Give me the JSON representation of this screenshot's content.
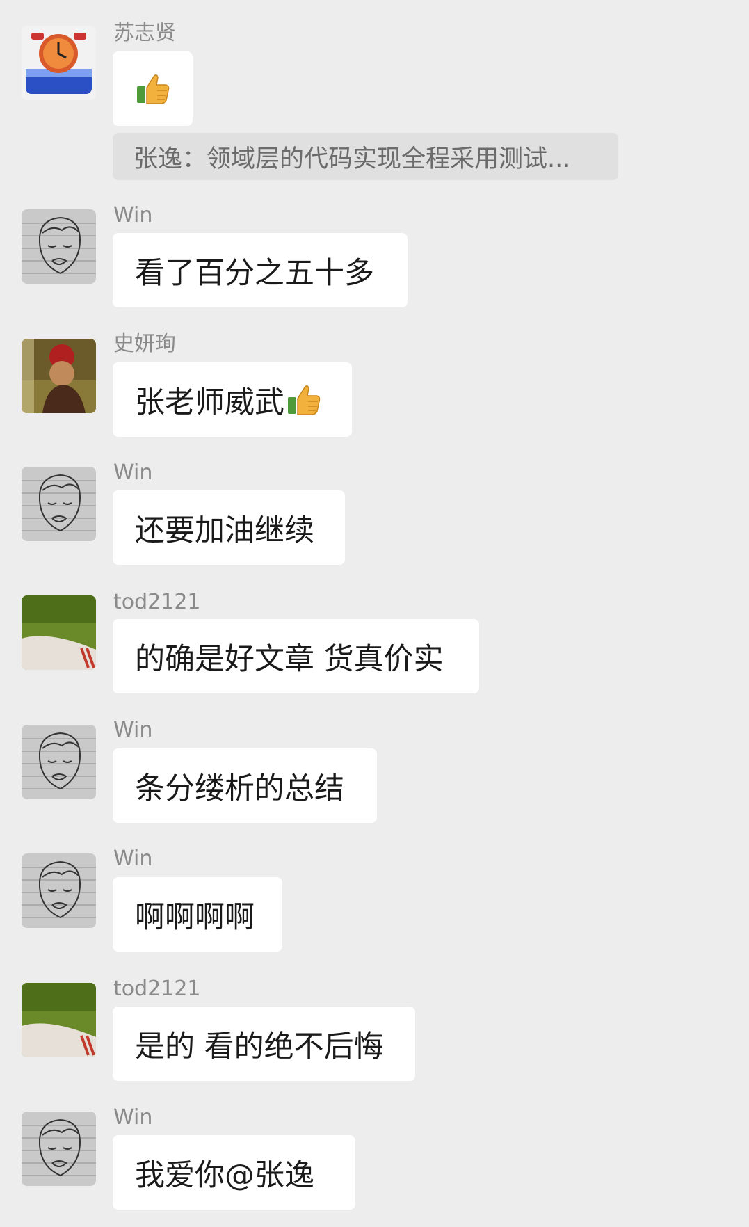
{
  "messages": [
    {
      "sender": "苏志贤",
      "text": "",
      "avatar": "clock-app-avatar",
      "emoji": "thumbs-up-icon",
      "quote": "张逸：领域层的代码实现全程采用测试..."
    },
    {
      "sender": "Win",
      "text": "看了百分之五十多",
      "avatar": "sketch-face-avatar"
    },
    {
      "sender": "史妍珣",
      "text": "张老师威武",
      "avatar": "game-character-avatar",
      "emoji": "thumbs-up-icon"
    },
    {
      "sender": "Win",
      "text": "还要加油继续",
      "avatar": "sketch-face-avatar"
    },
    {
      "sender": "tod2121",
      "text": "的确是好文章 货真价实",
      "avatar": "green-photo-avatar"
    },
    {
      "sender": "Win",
      "text": "条分缕析的总结",
      "avatar": "sketch-face-avatar"
    },
    {
      "sender": "Win",
      "text": "啊啊啊啊",
      "avatar": "sketch-face-avatar"
    },
    {
      "sender": "tod2121",
      "text": "是的 看的绝不后悔",
      "avatar": "green-photo-avatar"
    },
    {
      "sender": "Win",
      "text": "我爱你@张逸",
      "avatar": "sketch-face-avatar"
    }
  ],
  "colors": {
    "background": "#ededed",
    "bubble": "#ffffff",
    "quote_bg": "#e0e0e0",
    "name_text": "#8a8a8a"
  }
}
